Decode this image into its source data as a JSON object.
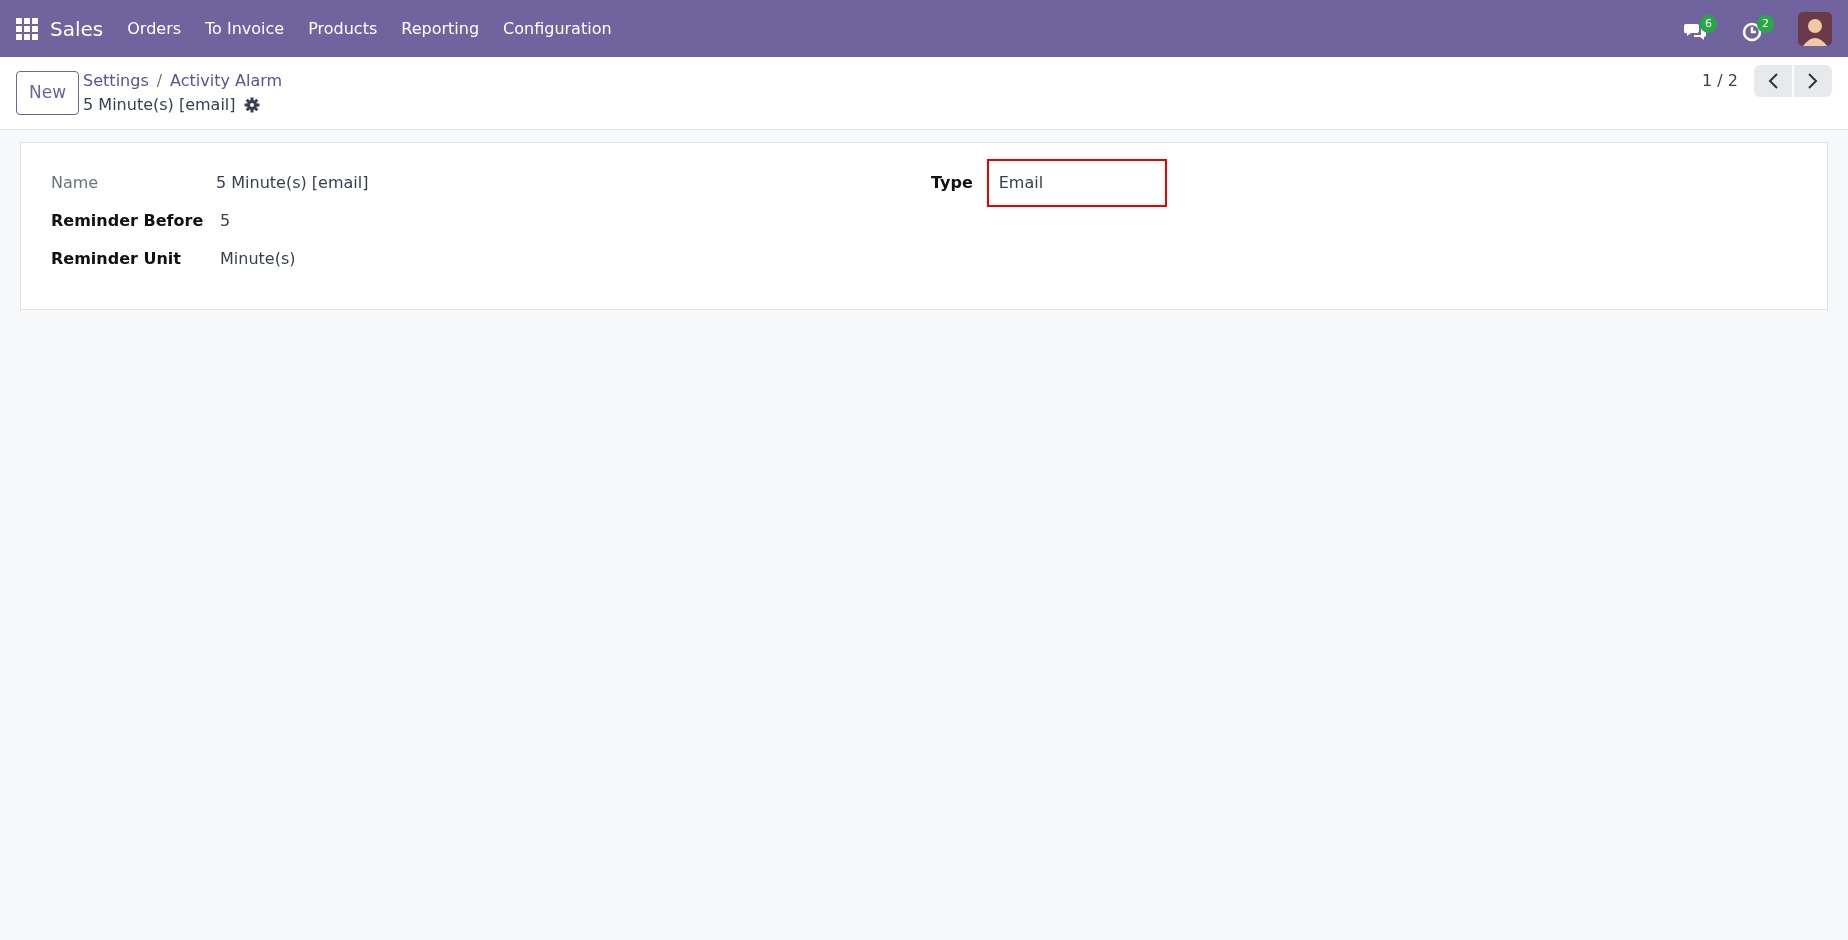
{
  "navbar": {
    "app": "Sales",
    "menu": [
      {
        "label": "Orders"
      },
      {
        "label": "To Invoice"
      },
      {
        "label": "Products"
      },
      {
        "label": "Reporting"
      },
      {
        "label": "Configuration"
      }
    ],
    "systray": [
      {
        "kind": "chat",
        "count": "6"
      },
      {
        "kind": "activity",
        "count": "2"
      }
    ]
  },
  "control_panel": {
    "new_button": "New",
    "breadcrumbs": [
      {
        "label": "Settings"
      },
      {
        "label": "Activity Alarm"
      }
    ],
    "breadcrumb_separator": "/",
    "record_title": "5 Minute(s) [email]",
    "pager": "1 / 2"
  },
  "form": {
    "left_fields": [
      {
        "label": "Name",
        "value": "5 Minute(s) [email]",
        "readonly": true
      },
      {
        "label": "Reminder Before",
        "value": "5",
        "readonly": false
      },
      {
        "label": "Reminder Unit",
        "value": "Minute(s)",
        "readonly": false
      }
    ],
    "right_fields": [
      {
        "label": "Type",
        "value": "Email",
        "readonly": false,
        "highlighted": true
      }
    ]
  }
}
